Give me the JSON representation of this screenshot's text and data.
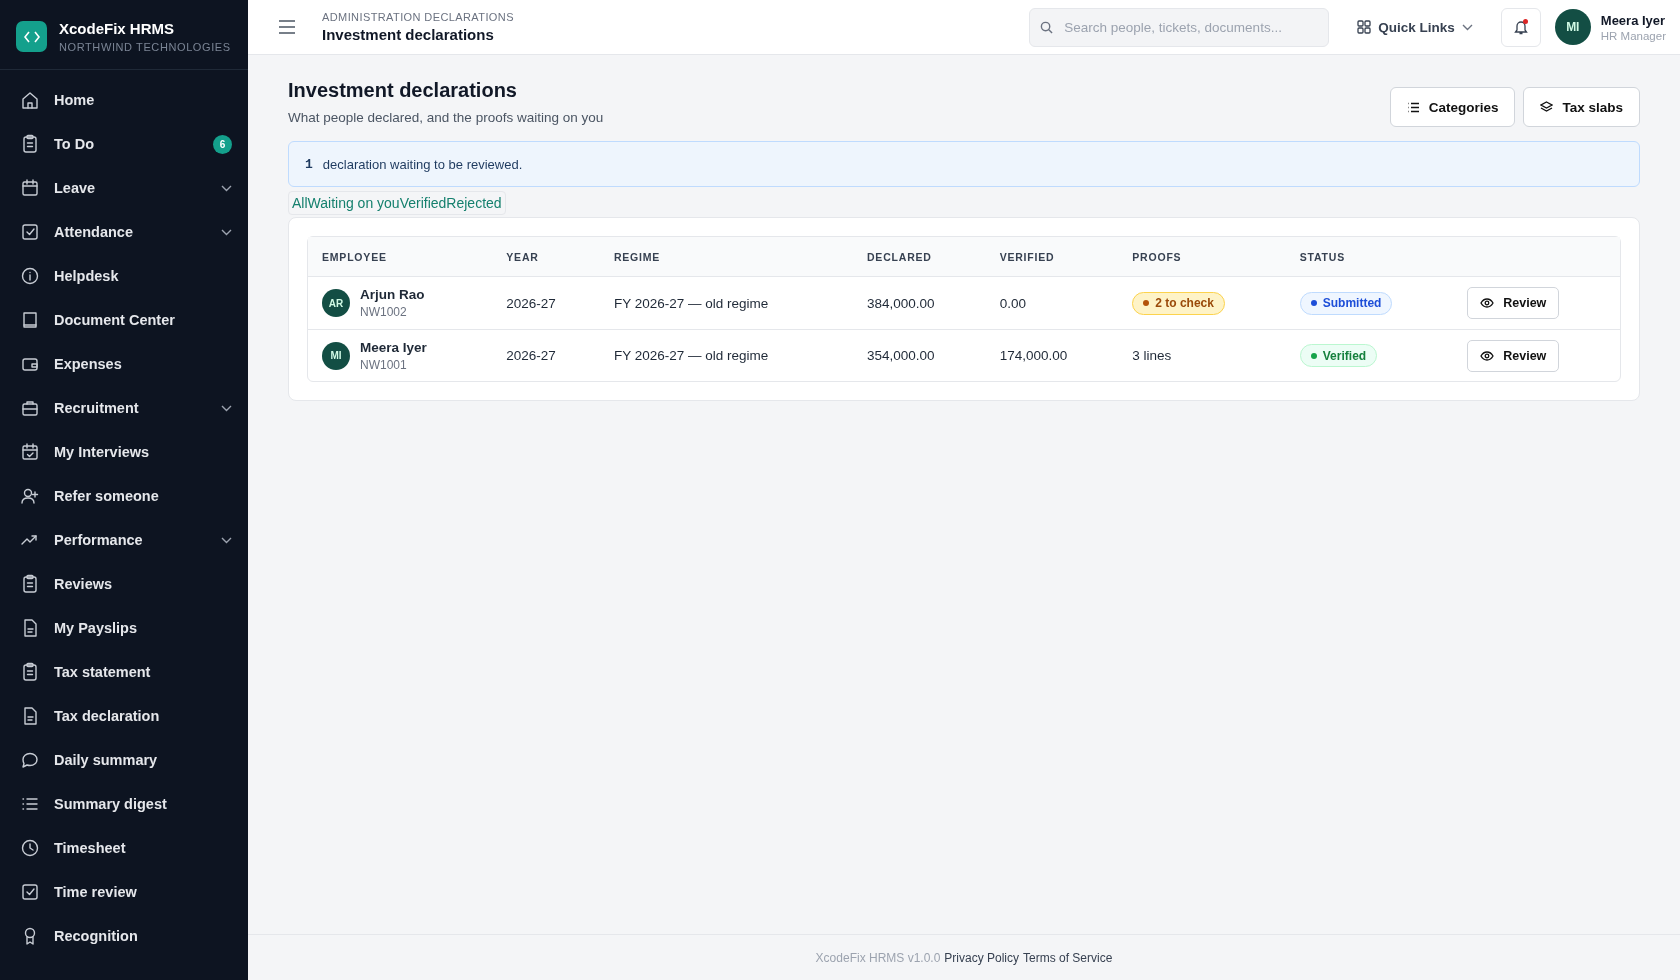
{
  "brand": {
    "name": "XcodeFix HRMS",
    "org": "NORTHWIND TECHNOLOGIES"
  },
  "sidebar": {
    "items": [
      {
        "label": "Home"
      },
      {
        "label": "To Do",
        "badge": "6"
      },
      {
        "label": "Leave",
        "expandable": true
      },
      {
        "label": "Attendance",
        "expandable": true
      },
      {
        "label": "Helpdesk"
      },
      {
        "label": "Document Center"
      },
      {
        "label": "Expenses"
      },
      {
        "label": "Recruitment",
        "expandable": true
      },
      {
        "label": "My Interviews"
      },
      {
        "label": "Refer someone"
      },
      {
        "label": "Performance",
        "expandable": true
      },
      {
        "label": "Reviews"
      },
      {
        "label": "My Payslips"
      },
      {
        "label": "Tax statement"
      },
      {
        "label": "Tax declaration"
      },
      {
        "label": "Daily summary"
      },
      {
        "label": "Summary digest"
      },
      {
        "label": "Timesheet"
      },
      {
        "label": "Time review"
      },
      {
        "label": "Recognition"
      }
    ]
  },
  "topbar": {
    "breadcrumb": "ADMINISTRATION DECLARATIONS",
    "title": "Investment declarations",
    "search": {
      "placeholder": "Search people, tickets, documents..."
    },
    "quick_links": "Quick Links",
    "notification_dot": true,
    "user": {
      "initials": "MI",
      "name": "Meera Iyer",
      "role": "HR Manager"
    }
  },
  "page": {
    "title": "Investment declarations",
    "subtitle": "What people declared, and the proofs waiting on you",
    "actions": [
      "Categories",
      "Tax slabs"
    ]
  },
  "notice": {
    "count": "1",
    "text": "declaration waiting to be reviewed."
  },
  "filters": [
    {
      "label": "All",
      "selected": false
    },
    {
      "label": "Waiting on you",
      "selected": false
    },
    {
      "label": "Verified",
      "selected": false
    },
    {
      "label": "Rejected",
      "selected": false
    }
  ],
  "table": {
    "columns": [
      "EMPLOYEE",
      "YEAR",
      "REGIME",
      "DECLARED",
      "VERIFIED",
      "PROOFS",
      "STATUS"
    ],
    "rows": [
      {
        "initials": "AR",
        "name": "Arjun Rao",
        "id": "NW1002",
        "year": "2026-27",
        "regime": "FY 2026-27 — old regime",
        "declared": "384,000.00",
        "verified": "0.00",
        "proofs": {
          "kind": "badge",
          "text": "2 to check"
        },
        "status": {
          "kind": "submitted",
          "text": "Submitted"
        },
        "action": "Review"
      },
      {
        "initials": "MI",
        "name": "Meera Iyer",
        "id": "NW1001",
        "year": "2026-27",
        "regime": "FY 2026-27 — old regime",
        "declared": "354,000.00",
        "verified": "174,000.00",
        "proofs": {
          "kind": "text",
          "text": "3 lines"
        },
        "status": {
          "kind": "verified",
          "text": "Verified"
        },
        "action": "Review"
      }
    ]
  },
  "footer": {
    "version": "XcodeFix HRMS v1.0.0",
    "links": [
      "Privacy Policy",
      "Terms of Service"
    ]
  }
}
